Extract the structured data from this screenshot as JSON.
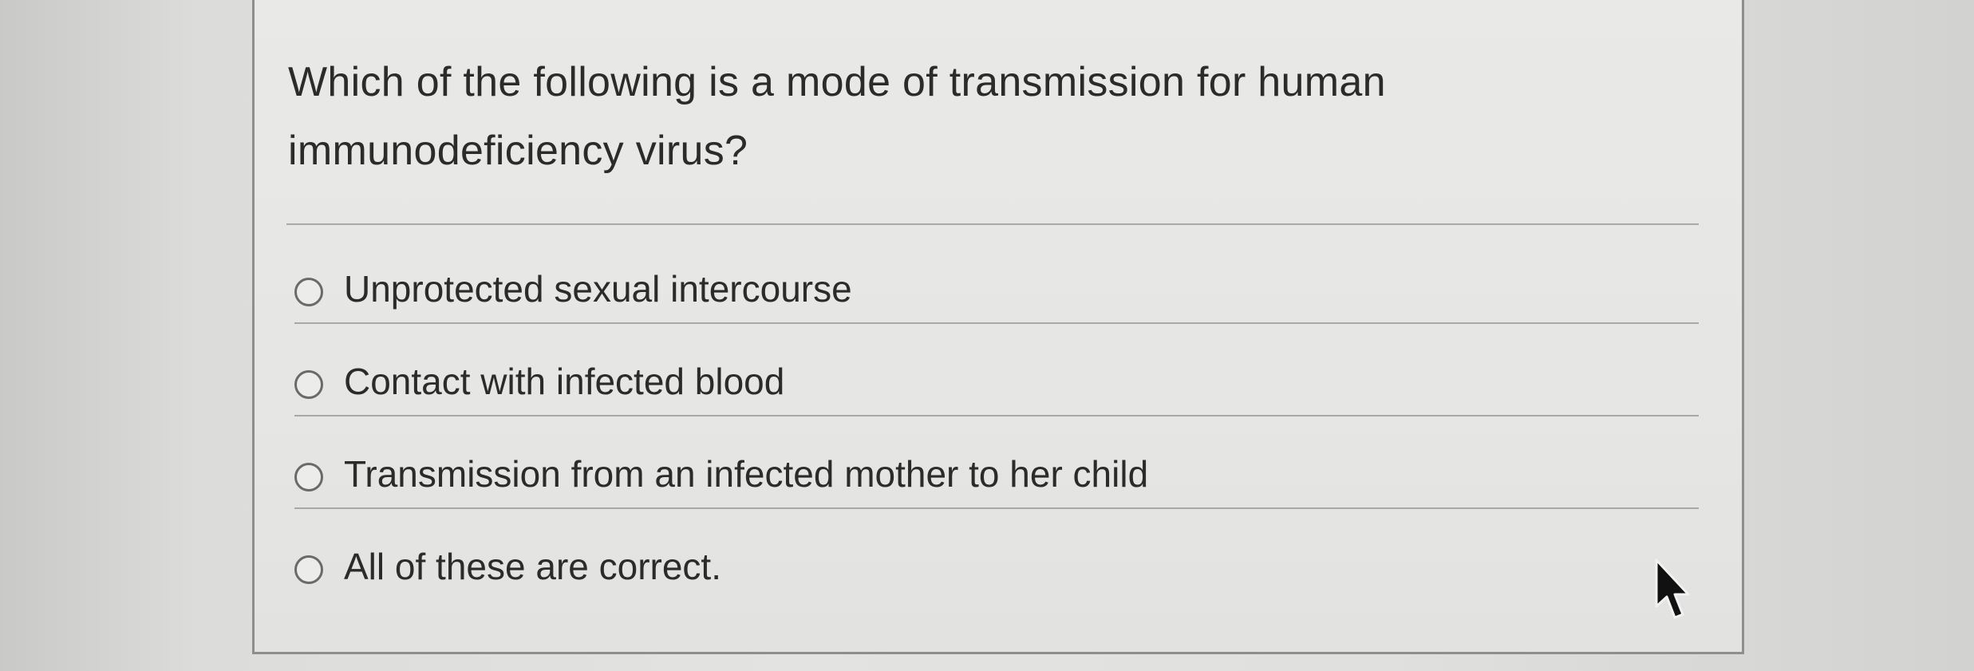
{
  "question": {
    "line1": "Which of the following is a mode of transmission for human",
    "line2": "immunodeficiency virus?"
  },
  "answers": [
    {
      "label": "Unprotected sexual intercourse",
      "selected": false
    },
    {
      "label": "Contact with infected blood",
      "selected": false
    },
    {
      "label": "Transmission from an infected mother to her child",
      "selected": false
    },
    {
      "label": "All of these are correct.",
      "selected": false
    }
  ],
  "icons": {
    "radio": "radio-button-icon",
    "cursor": "mouse-pointer-icon"
  }
}
